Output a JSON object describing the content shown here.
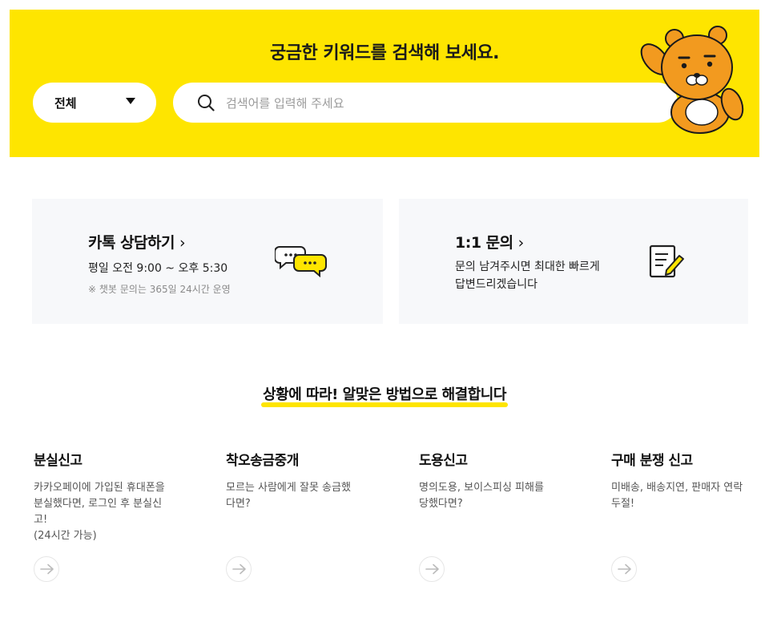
{
  "hero": {
    "title": "궁금한 키워드를 검색해 보세요.",
    "scope_select": {
      "selected": "전체"
    },
    "search": {
      "placeholder": "검색어를 입력해 주세요",
      "value": ""
    },
    "mascot": "ryan-character"
  },
  "cards": [
    {
      "title": "카톡 상담하기",
      "chevron": "›",
      "desc": "평일 오전 9:00 ~ 오후 5:30",
      "note": "※ 챗봇 문의는 365일 24시간 운영",
      "icon": "chat-bubbles-icon"
    },
    {
      "title": "1:1 문의",
      "chevron": "›",
      "desc_lines": [
        "문의 남겨주시면 최대한 빠르게",
        "답변드리겠습니다"
      ],
      "icon": "note-pencil-icon"
    }
  ],
  "section": {
    "title": "상황에 따라! 알맞은 방법으로 해결합니다"
  },
  "categories": [
    {
      "title": "분실신고",
      "desc_lines": [
        "카카오페이에 가입된 휴대폰을",
        "분실했다면, 로그인 후 분실신",
        "고!",
        "(24시간 가능)"
      ]
    },
    {
      "title": "착오송금중개",
      "desc_lines": [
        "모르는 사람에게 잘못 송금했",
        "다면?"
      ]
    },
    {
      "title": "도용신고",
      "desc_lines": [
        "명의도용, 보이스피싱 피해를",
        "당했다면?"
      ]
    },
    {
      "title": "구매 분쟁 신고",
      "desc_lines": [
        "미배송, 배송지연, 판매자 연락",
        "두절!"
      ]
    }
  ],
  "colors": {
    "brand_yellow": "#fee500",
    "card_bg": "#f7f8fa"
  }
}
